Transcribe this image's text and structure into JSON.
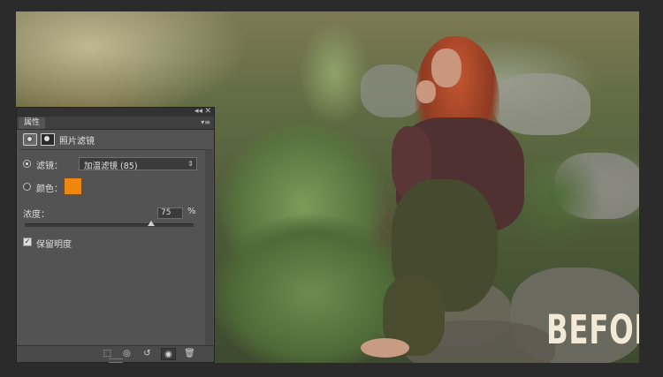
{
  "panel": {
    "tab_label": "属性",
    "topbar": {
      "collapse_glyph": "◂◂",
      "close_glyph": "✕"
    },
    "menu_glyph": "▾≡",
    "title": "照片滤镜",
    "filter": {
      "label": "滤镜：",
      "value": "加温滤镜 (85)",
      "selected": true
    },
    "color": {
      "label": "颜色：",
      "hex": "#f0860e",
      "selected": false
    },
    "density": {
      "label": "浓度：",
      "value": "75",
      "unit": "%",
      "level_percent": 75
    },
    "preserve_luminosity": {
      "label": "保留明度",
      "checked": true
    },
    "icons": [
      "adjustment-layer-icon",
      "mask-icon"
    ],
    "bottom_buttons": [
      {
        "name": "clip-to-layer-icon",
        "glyph": "⬚"
      },
      {
        "name": "view-previous-icon",
        "glyph": "◎"
      },
      {
        "name": "reset-icon",
        "glyph": "↺"
      },
      {
        "name": "visibility-eye-icon",
        "glyph": "◉"
      },
      {
        "name": "trash-icon",
        "glyph": "🗑"
      }
    ]
  },
  "canvas": {
    "overlay_text": "BEFORE"
  }
}
